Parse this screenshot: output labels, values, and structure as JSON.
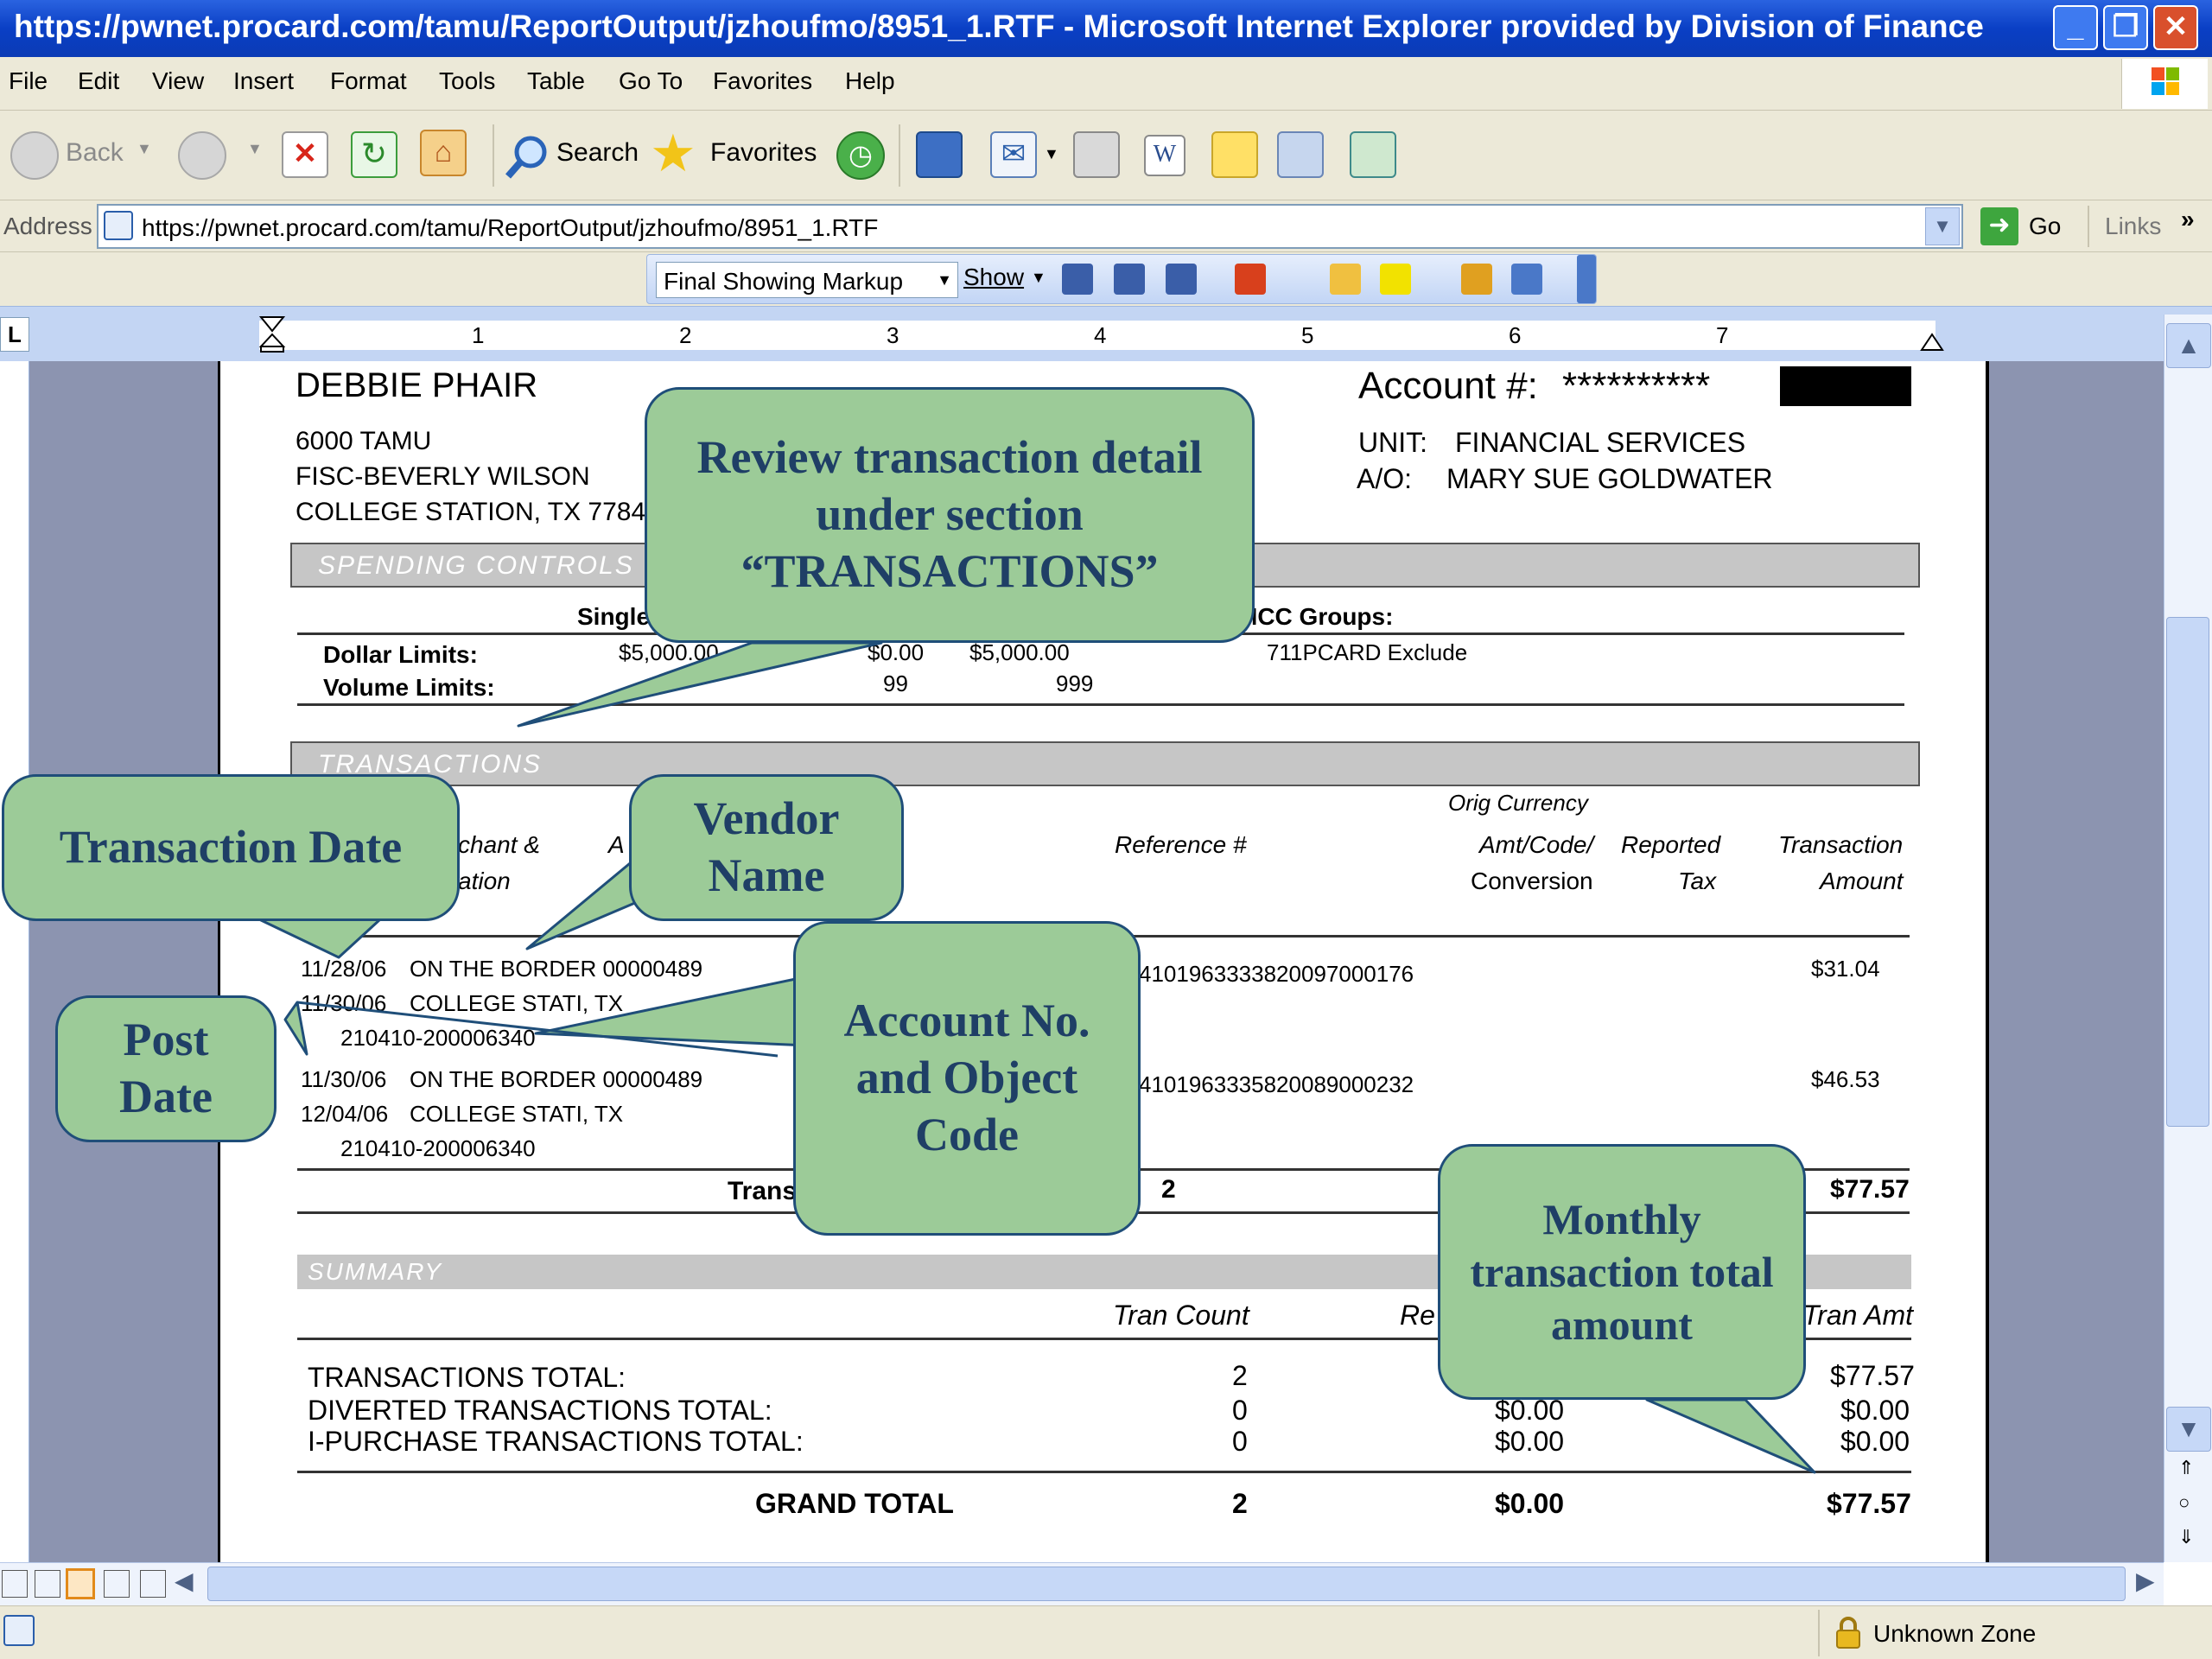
{
  "window": {
    "title": "https://pwnet.procard.com/tamu/ReportOutput/jzhoufmo/8951_1.RTF - Microsoft Internet Explorer provided by Division of Finance"
  },
  "menu": [
    "File",
    "Edit",
    "View",
    "Insert",
    "Format",
    "Tools",
    "Table",
    "Go To",
    "Favorites",
    "Help"
  ],
  "toolbar": {
    "back": "Back",
    "search": "Search",
    "favorites": "Favorites"
  },
  "address": {
    "label": "Address",
    "url": "https://pwnet.procard.com/tamu/ReportOutput/jzhoufmo/8951_1.RTF",
    "go": "Go",
    "links": "Links"
  },
  "review": {
    "markup": "Final Showing Markup",
    "show": "Show"
  },
  "ruler": [
    "1",
    "2",
    "3",
    "4",
    "5",
    "6",
    "7"
  ],
  "status": {
    "zone": "Unknown Zone"
  },
  "report": {
    "name": "DEBBIE PHAIR",
    "address1": "6000 TAMU",
    "address2": "FISC-BEVERLY WILSON",
    "address3": "COLLEGE STATION, TX 7784",
    "account_label": "Account #:",
    "account_mask": "**********",
    "unit_label": "UNIT:",
    "unit_value": "FINANCIAL SERVICES",
    "ao_label": "A/O:",
    "ao_value": "MARY SUE GOLDWATER",
    "spending": {
      "title": "SPENDING CONTROLS",
      "col_single": "Single",
      "col_mcc": "MCC Groups:",
      "dollar_label": "Dollar Limits:",
      "dollar_single": "$5,000.00",
      "dollar_mid": "$0.00",
      "dollar_monthly": "$5,000.00",
      "mcc_value": "711PCARD Exclude",
      "volume_label": "Volume Limits:",
      "volume_a": "99",
      "volume_b": "999"
    },
    "transactions": {
      "title": "TRANSACTIONS",
      "col_merchant_a": "chant &",
      "col_merchant_b": "ation",
      "col_a": "A",
      "col_ref": "Reference #",
      "col_orig": "Orig Currency",
      "col_amt_code": "Amt/Code/",
      "col_conversion": "Conversion",
      "col_reported": "Reported",
      "col_tax": "Tax",
      "col_trans": "Transaction",
      "col_amount": "Amount",
      "rows": [
        {
          "tdate": "11/28/06",
          "vendor": "ON THE BORDER 00000489",
          "pdate": "11/30/06",
          "city": "COLLEGE STATI, TX",
          "acct": "210410-200006340",
          "ref": "4101963333820097000176",
          "amount": "$31.04"
        },
        {
          "tdate": "11/30/06",
          "vendor": "ON THE BORDER 00000489",
          "pdate": "12/04/06",
          "city": "COLLEGE STATI, TX",
          "acct": "210410-200006340",
          "ref": "4101963335820089000232",
          "amount": "$46.53"
        }
      ],
      "total_label": "Trans",
      "total_count": "2",
      "total_amount": "$77.57"
    },
    "summary": {
      "title": "SUMMARY",
      "col_count": "Tran Count",
      "col_rep": "Re",
      "col_amt": "Tran Amt",
      "rows": [
        {
          "label": "TRANSACTIONS TOTAL:",
          "count": "2",
          "tax": "",
          "amt": "$77.57"
        },
        {
          "label": "DIVERTED TRANSACTIONS TOTAL:",
          "count": "0",
          "tax": "$0.00",
          "amt": "$0.00"
        },
        {
          "label": "I-PURCHASE TRANSACTIONS TOTAL:",
          "count": "0",
          "tax": "$0.00",
          "amt": "$0.00"
        }
      ],
      "grand_label": "GRAND TOTAL",
      "grand_count": "2",
      "grand_tax": "$0.00",
      "grand_amt": "$77.57"
    }
  },
  "callouts": {
    "review": "Review transaction detail under section “TRANSACTIONS”",
    "tdate": "Transaction Date",
    "vendor": "Vendor Name",
    "post": "Post Date",
    "account": "Account No. and Object Code",
    "monthly": "Monthly transaction total amount"
  },
  "colors": {
    "callout_fill": "#9ccb98",
    "callout_text": "#1f3f66",
    "titlebar": "#0a3fc5",
    "section_band": "#c6c6c6"
  },
  "icons": [
    "back-icon",
    "forward-icon",
    "stop-icon",
    "refresh-icon",
    "home-icon",
    "search-icon",
    "favorites-star-icon",
    "history-icon",
    "mail-icon",
    "print-icon",
    "word-icon",
    "note-icon",
    "research-icon",
    "messenger-icon",
    "windows-logo-icon",
    "lock-icon"
  ]
}
